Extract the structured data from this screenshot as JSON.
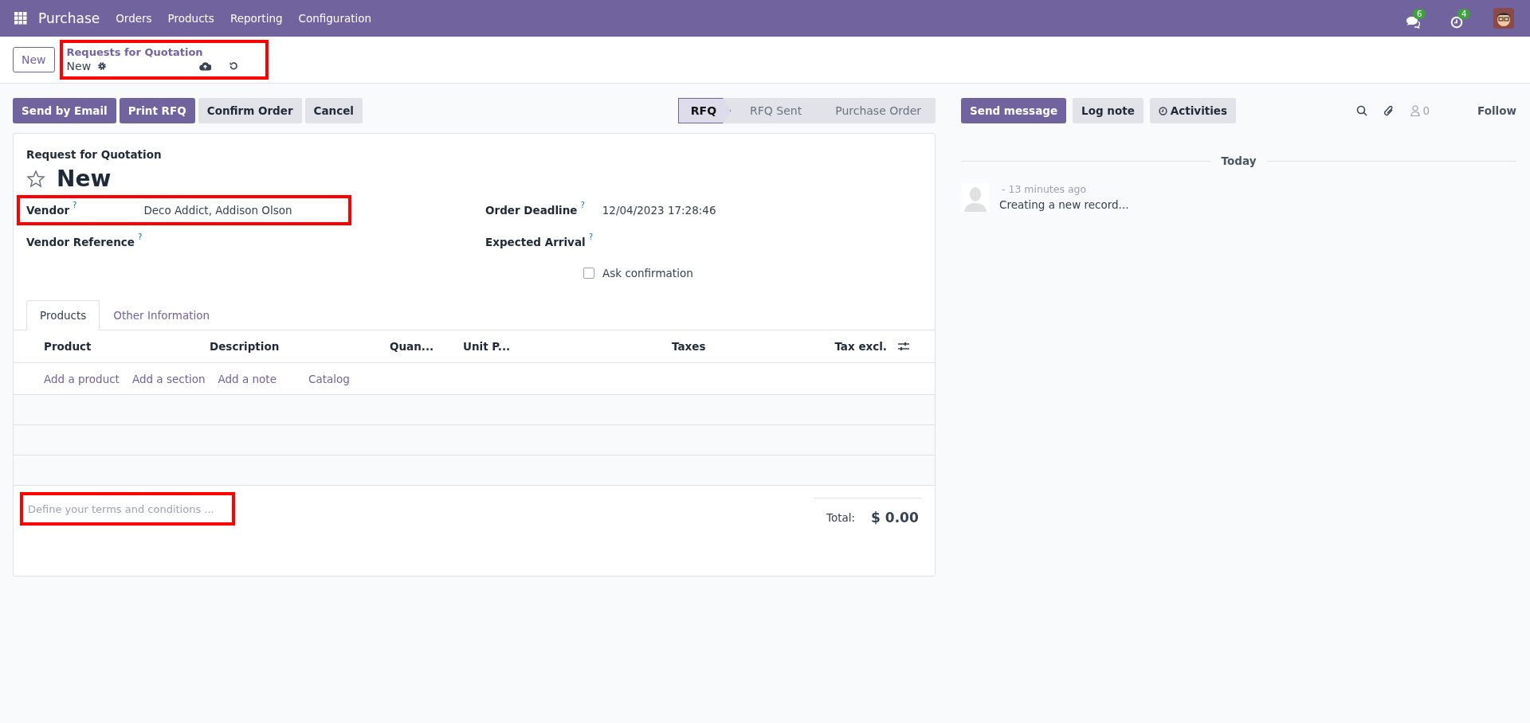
{
  "navbar": {
    "app_name": "Purchase",
    "menu": [
      "Orders",
      "Products",
      "Reporting",
      "Configuration"
    ],
    "messages_count": "6",
    "activities_count": "4"
  },
  "control_panel": {
    "new_button": "New",
    "breadcrumb": "Requests for Quotation",
    "record_name": "New",
    "highlighted": true
  },
  "actions": [
    {
      "label": "Send by Email",
      "kind": "primary"
    },
    {
      "label": "Print RFQ",
      "kind": "primary"
    },
    {
      "label": "Confirm Order",
      "kind": "secondary"
    },
    {
      "label": "Cancel",
      "kind": "secondary"
    }
  ],
  "statusbar": [
    {
      "label": "RFQ",
      "selected": true
    },
    {
      "label": "RFQ Sent",
      "selected": false
    },
    {
      "label": "Purchase Order",
      "selected": false
    }
  ],
  "form": {
    "subtitle": "Request for Quotation",
    "title": "New",
    "starred": false,
    "left_fields": [
      {
        "label": "Vendor",
        "help": "?",
        "value": "Deco Addict, Addison Olson",
        "highlighted": true
      },
      {
        "label": "Vendor Reference",
        "help": "?",
        "highlighted": false
      }
    ],
    "right_fields": [
      {
        "label": "Order Deadline",
        "help": "?",
        "value": "12/04/2023 17:28:46"
      },
      {
        "label": "Expected Arrival",
        "help": "?"
      }
    ],
    "ask_confirmation": {
      "label": "Ask confirmation",
      "checked": false
    },
    "tabs": [
      {
        "label": "Products",
        "selected": true
      },
      {
        "label": "Other Information",
        "selected": false
      }
    ],
    "table": {
      "columns": [
        "Product",
        "Description",
        "Quan...",
        "Unit P...",
        "Taxes",
        "Tax excl."
      ],
      "add_links": [
        "Add a product",
        "Add a section",
        "Add a note",
        "Catalog"
      ]
    },
    "terms": {
      "placeholder": "Define your terms and conditions ...",
      "highlighted": true
    },
    "total_label": "Total:",
    "total_value": "$ 0.00"
  },
  "chatter": {
    "buttons": [
      {
        "label": "Send message",
        "kind": "primary"
      },
      {
        "label": "Log note",
        "kind": "secondary"
      },
      {
        "label": "Activities",
        "kind": "activities"
      }
    ],
    "followers_count": "0",
    "follow": "Follow",
    "date_separator": "Today",
    "messages": [
      {
        "time": "- 13 minutes ago",
        "body": "Creating a new record..."
      }
    ]
  }
}
